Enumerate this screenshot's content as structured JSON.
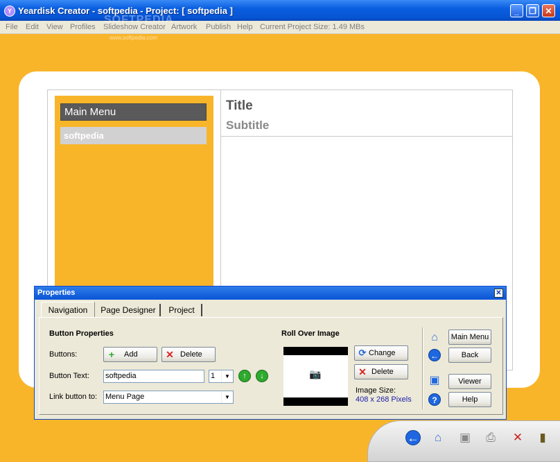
{
  "window": {
    "title": "Yeardisk Creator - softpedia - Project: [ softpedia ]",
    "app_icon": "Y",
    "minimize": "_",
    "maximize": "❐",
    "close": "✕"
  },
  "menubar": {
    "items": [
      "File",
      "Edit",
      "View",
      "Profiles",
      "Slideshow Creator",
      "Artwork",
      "Publish",
      "Help"
    ],
    "project_size": "Current Project Size: 1.49 MBs"
  },
  "watermark": {
    "text": "SOFTPEDIA",
    "url": "www.softpedia.com"
  },
  "preview_page": {
    "menu_header": "Main Menu",
    "menu_item": "softpedia",
    "title": "Title",
    "subtitle": "Subtitle"
  },
  "properties": {
    "title": "Properties",
    "close": "✕",
    "tabs": [
      "Navigation",
      "Page Designer",
      "Project"
    ],
    "active_tab": "Navigation",
    "button_properties_heading": "Button Properties",
    "buttons_label": "Buttons:",
    "add_label": "Add",
    "delete_label": "Delete",
    "button_text_label": "Button Text:",
    "button_text_value": "softpedia",
    "order_value": "1",
    "link_label": "Link button to:",
    "link_value": "Menu Page",
    "roll_over_heading": "Roll Over Image",
    "change_label": "Change",
    "image_delete_label": "Delete",
    "image_size_label": "Image Size:",
    "image_size_value": "408 x 268 Pixels",
    "nav_buttons": {
      "main_menu": "Main Menu",
      "back": "Back",
      "viewer": "Viewer",
      "help": "Help"
    }
  },
  "icons": {
    "add": "plus-icon",
    "delete": "x-icon",
    "up": "arrow-up-icon",
    "down": "arrow-down-icon",
    "home": "home-icon",
    "back": "back-arrow-icon",
    "viewer": "monitor-icon",
    "help": "help-icon",
    "camera": "camera-icon",
    "change": "refresh-icon"
  },
  "colors": {
    "background": "#f9b52a",
    "titlebar": "#0a5fe0",
    "menu_header": "#5a5a5a",
    "menu_item": "#d1d1d1",
    "image_size_text": "#1a1aa8"
  }
}
